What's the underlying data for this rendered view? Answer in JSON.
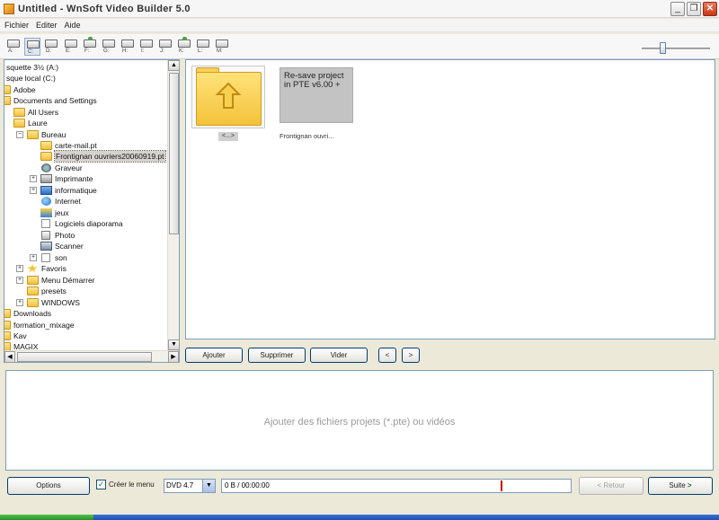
{
  "window": {
    "title": "Untitled - WnSoft Video Builder 5.0",
    "buttons": {
      "minimize": "_",
      "maximize": "❐",
      "close": "✕"
    }
  },
  "menu": [
    "Fichier",
    "Editer",
    "Aide"
  ],
  "drives": [
    "A:",
    "C:",
    "D:",
    "E:",
    "F:",
    "G:",
    "H:",
    "I:",
    "J:",
    "K:",
    "L:",
    "M:"
  ],
  "tree": {
    "items": [
      "squette 3½ (A:)",
      "sque local (C:)",
      "Adobe",
      "Documents and Settings",
      "All Users",
      "Laure",
      "Bureau",
      "carte-mail.pt",
      "Frontignan ouvriers20060919.pt",
      "Graveur",
      "Imprimante",
      "informatique",
      "Internet",
      "jeux",
      "Logiciels diaporama",
      "Photo",
      "Scanner",
      "son",
      "Favoris",
      "Menu Démarrer",
      "presets",
      "WINDOWS",
      "Downloads",
      "formation_mixage",
      "Kav",
      "MAGIX"
    ]
  },
  "files": {
    "up_label": "<...>",
    "project_thumb_text": "Re-save project in PTE v6.00 +",
    "project_label": "Frontignan ouvri..."
  },
  "file_buttons": {
    "add": "Ajouter",
    "delete": "Supprimer",
    "clear": "Vider",
    "prev": "<",
    "next": ">"
  },
  "dropzone": {
    "text": "Ajouter des fichiers projets (*.pte) ou vidéos"
  },
  "bottom": {
    "options": "Options",
    "create_menu": "Créer le menu",
    "create_menu_checked": true,
    "format": "DVD 4.7",
    "status": "0 B / 00:00:00",
    "back": "Retour",
    "next": "Suite"
  }
}
